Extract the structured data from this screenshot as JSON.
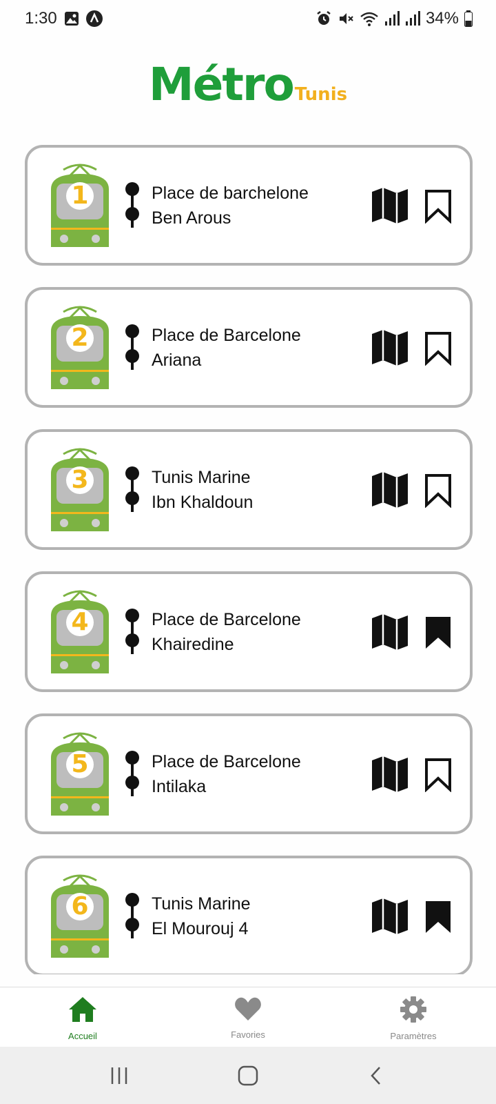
{
  "status_bar": {
    "time": "1:30",
    "battery": "34%",
    "icons": [
      "image-icon",
      "a-badge-icon",
      "alarm-icon",
      "mute-icon",
      "wifi-icon",
      "signal-icon",
      "signal-icon",
      "battery-icon"
    ]
  },
  "header": {
    "logo_main": "Métro",
    "logo_sub": "Tunis",
    "logo_color": "#1f9e3a",
    "logo_accent": "#f2b01e"
  },
  "lines": [
    {
      "number": "1",
      "from": "Place de barchelone",
      "to": "Ben Arous",
      "saved": false
    },
    {
      "number": "2",
      "from": "Place de Barcelone",
      "to": "Ariana",
      "saved": false
    },
    {
      "number": "3",
      "from": "Tunis Marine",
      "to": "Ibn Khaldoun",
      "saved": false
    },
    {
      "number": "4",
      "from": "Place de Barcelone",
      "to": "Khairedine",
      "saved": true
    },
    {
      "number": "5",
      "from": "Place de Barcelone",
      "to": "Intilaka",
      "saved": false
    },
    {
      "number": "6",
      "from": "Tunis Marine",
      "to": "El Mourouj 4",
      "saved": true
    }
  ],
  "bottom_nav": {
    "items": [
      {
        "label": "Accueil",
        "icon": "home-icon",
        "active": true
      },
      {
        "label": "Favories",
        "icon": "heart-icon",
        "active": false
      },
      {
        "label": "Paramètres",
        "icon": "gear-icon",
        "active": false
      }
    ],
    "active_color": "#1f7d1f",
    "inactive_color": "#888888"
  },
  "system_nav": [
    "recents-icon",
    "home-button-icon",
    "back-icon"
  ]
}
